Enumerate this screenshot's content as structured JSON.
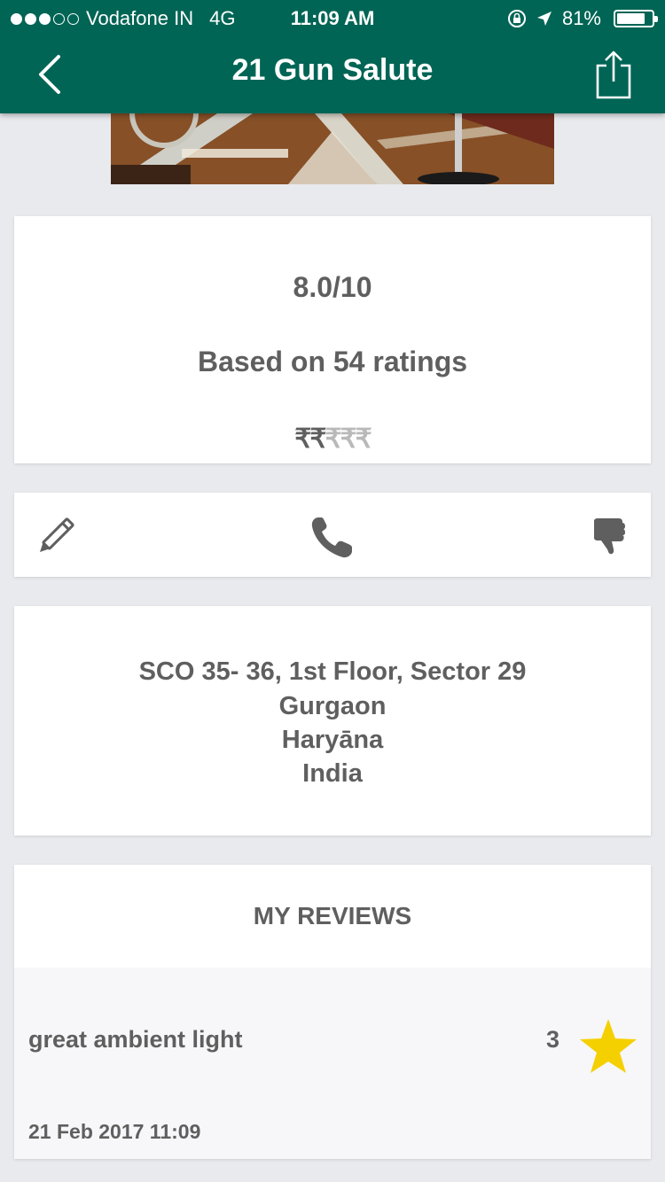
{
  "status_bar": {
    "carrier": "Vodafone IN",
    "network": "4G",
    "time": "11:09 AM",
    "battery": "81%",
    "battery_level": 0.81,
    "signal_strength": 3
  },
  "nav": {
    "title": "21 Gun Salute",
    "back_icon": "chevron-left-icon",
    "share_icon": "share-icon"
  },
  "rating": {
    "score": "8.0/10",
    "based_on": "Based on 54 ratings",
    "price_active": "₹₹",
    "price_inactive": "₹₹₹",
    "price_level": 2
  },
  "actions": {
    "edit_icon": "pencil-icon",
    "call_icon": "phone-icon",
    "dislike_icon": "thumbs-down-icon"
  },
  "address": {
    "line1": "SCO 35- 36, 1st Floor, Sector 29",
    "line2": "Gurgaon",
    "line3": "Haryāna",
    "line4": "India"
  },
  "reviews": {
    "title": "MY REVIEWS",
    "items": [
      {
        "text": "great ambient light",
        "score": "3",
        "date": "21 Feb 2017 11:09",
        "icon": "star-icon"
      }
    ]
  },
  "colors": {
    "header": "#006555",
    "background": "#e9eaee",
    "text": "#5f5f5f",
    "star": "#f5d000"
  }
}
